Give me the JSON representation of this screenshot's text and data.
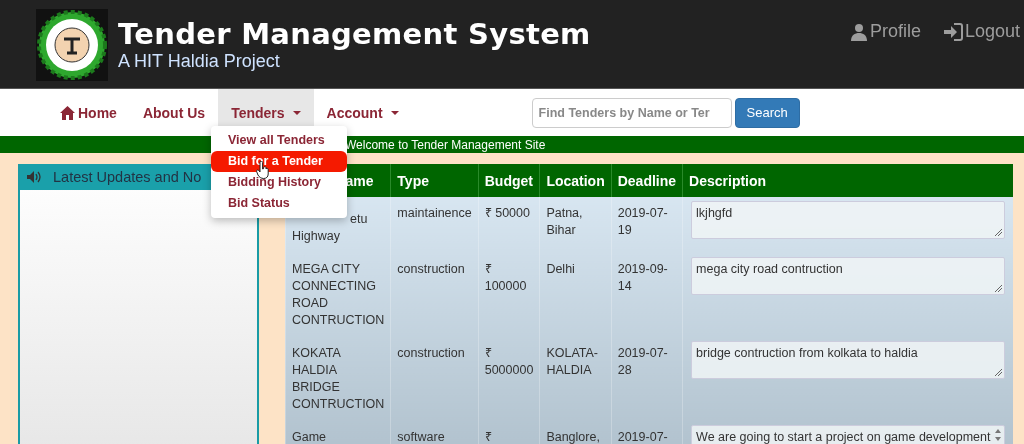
{
  "header": {
    "title": "Tender Management System",
    "subtitle": "A HIT Haldia Project",
    "links": [
      {
        "kind": "profile",
        "label": "Profile"
      },
      {
        "kind": "logout",
        "label": "Logout"
      }
    ]
  },
  "nav": {
    "items": [
      {
        "kind": "home",
        "label": "Home",
        "selected": false,
        "dropdown": false
      },
      {
        "kind": "plain",
        "label": "About Us",
        "selected": false,
        "dropdown": false
      },
      {
        "kind": "plain",
        "label": "Tenders",
        "selected": true,
        "dropdown": true
      },
      {
        "kind": "plain",
        "label": "Account",
        "selected": false,
        "dropdown": true
      }
    ],
    "search": {
      "placeholder": "Find Tenders by Name or Ter",
      "button": "Search"
    }
  },
  "dropdown": {
    "items": [
      {
        "label": "View all Tenders",
        "selected": false
      },
      {
        "label": "Bid for a Tender",
        "selected": true
      },
      {
        "label": "Bidding History",
        "selected": false
      },
      {
        "label": "Bid Status",
        "selected": false
      }
    ]
  },
  "marquee": "Welcome to Tender Management Site",
  "updates_panel": {
    "title": "Latest Updates and No"
  },
  "table": {
    "columns": [
      "ame",
      "Type",
      "Budget",
      "Location",
      "Deadline",
      "Description"
    ],
    "rows": [
      {
        "name": "etu Highway",
        "type": "maintainence",
        "budget": "₹ 50000",
        "location": "Patna, Bihar",
        "deadline": "2019-07-19",
        "description": "lkjhgfd",
        "scroll": false
      },
      {
        "name": "MEGA CITY CONNECTING ROAD CONTRUCTION",
        "type": "construction",
        "budget": "₹ 100000",
        "location": "Delhi",
        "deadline": "2019-09-14",
        "description": "mega city road contruction",
        "scroll": false
      },
      {
        "name": "KOKATA HALDIA BRIDGE CONTRUCTION",
        "type": "construction",
        "budget": "₹ 5000000",
        "location": "KOLATA-HALDIA",
        "deadline": "2019-07-28",
        "description": "bridge contruction from kolkata to haldia",
        "scroll": false
      },
      {
        "name": "Game",
        "type": "software",
        "budget": "₹",
        "location": "Banglore,",
        "deadline": "2019-07-",
        "description": "We are going to start a project on game development",
        "scroll": true
      }
    ]
  }
}
